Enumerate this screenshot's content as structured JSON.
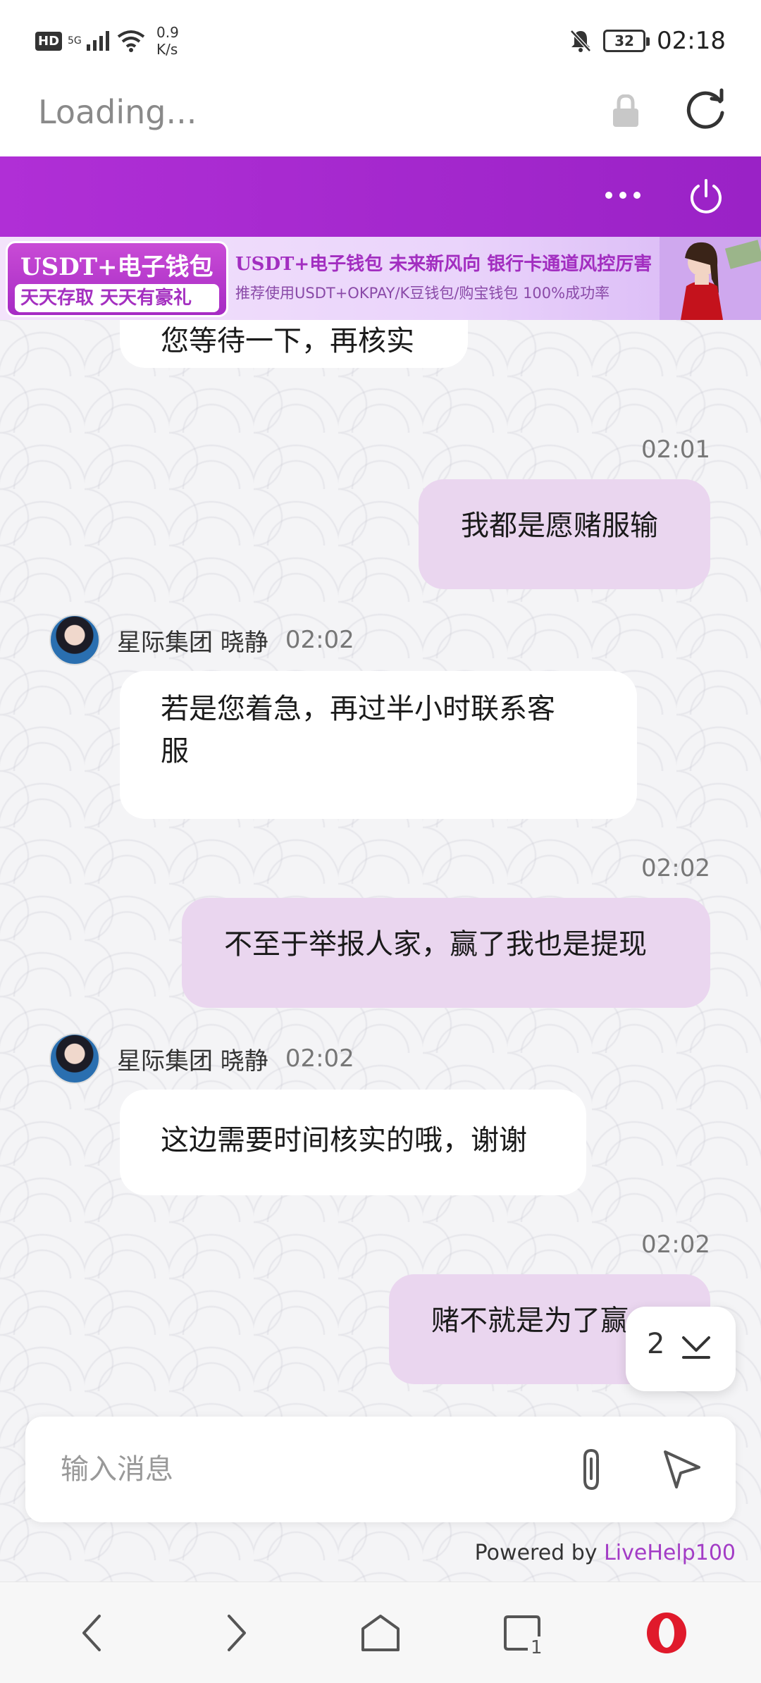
{
  "status_bar": {
    "hd": "HD",
    "network": "5G",
    "speed_value": "0.9",
    "speed_unit": "K/s",
    "battery": "32",
    "time": "02:18",
    "icons": [
      "signal-icon",
      "wifi-icon",
      "mute-bell-icon",
      "battery-icon"
    ]
  },
  "browser": {
    "url_text": "Loading...",
    "icons": [
      "lock-icon",
      "reload-icon"
    ]
  },
  "header": {
    "accent": "#a628cf",
    "icons": [
      "more-icon",
      "power-icon"
    ]
  },
  "banner": {
    "badge_title": "USDT+电子钱包",
    "badge_subtitle": "天天存取 天天有豪礼",
    "headline": "USDT+电子钱包  未来新风向  银行卡通道风控厉害",
    "subline": "推荐使用USDT+OKPAY/K豆钱包/购宝钱包  100%成功率"
  },
  "messages": [
    {
      "direction": "in",
      "text": "您等待一下，再核实"
    },
    {
      "direction": "out",
      "time": "02:01",
      "text": "我都是愿赌服输"
    },
    {
      "direction": "in",
      "sender": "星际集团 晓静",
      "time": "02:02",
      "text": "若是您着急，再过半小时联系客",
      "text2": "服"
    },
    {
      "direction": "out",
      "time": "02:02",
      "text": "不至于举报人家，赢了我也是提现"
    },
    {
      "direction": "in",
      "sender": "星际集团 晓静",
      "time": "02:02",
      "text": "这边需要时间核实的哦，谢谢"
    },
    {
      "direction": "out",
      "time": "02:02",
      "text": "赌不就是为了赢"
    }
  ],
  "unread": {
    "count": "2"
  },
  "composer": {
    "placeholder": "输入消息"
  },
  "footer": {
    "powered_prefix": "Powered by ",
    "powered_brand": "LiveHelp100"
  },
  "colors": {
    "out_bubble": "#ead6ef",
    "in_bubble": "#ffffff",
    "brand_link": "#a33cc6"
  }
}
